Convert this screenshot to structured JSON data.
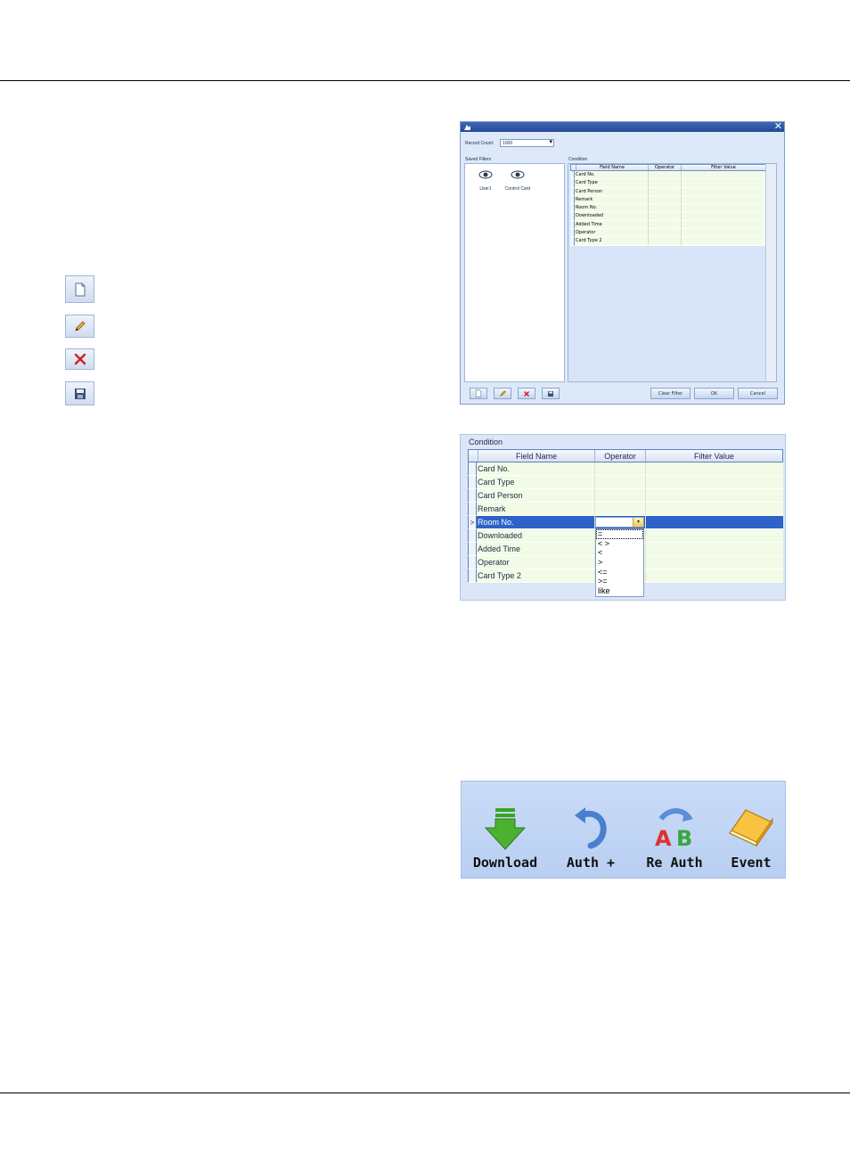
{
  "dialog": {
    "record_count_label": "Record Count:",
    "record_count_value": "1000",
    "saved_filters_label": "Saved Filters",
    "condition_label": "Condition",
    "saved_filters": [
      {
        "label": "User1"
      },
      {
        "label": "Control Card"
      }
    ],
    "grid_headers": [
      "Field Name",
      "Operator",
      "Filter Value"
    ],
    "grid_rows": [
      "Card No.",
      "Card Type",
      "Card Person",
      "Remark",
      "Room No.",
      "Downloaded",
      "Added Time",
      "Operator",
      "Card Type 2"
    ],
    "buttons": {
      "clear_filter": "Clear Filter",
      "ok": "OK",
      "cancel": "Cancel"
    }
  },
  "condition": {
    "title": "Condition",
    "headers": [
      "Field Name",
      "Operator",
      "Filter Value"
    ],
    "rows": [
      {
        "field": "Card No."
      },
      {
        "field": "Card Type"
      },
      {
        "field": "Card Person"
      },
      {
        "field": "Remark"
      },
      {
        "field": "Room No.",
        "selected": true
      },
      {
        "field": "Downloaded"
      },
      {
        "field": "Added Time"
      },
      {
        "field": "Operator"
      },
      {
        "field": "Card Type 2"
      }
    ],
    "row_indicator": ">",
    "operators": [
      "=",
      "< >",
      "<",
      ">",
      "<=",
      ">=",
      "like"
    ],
    "selected_operator": "="
  },
  "toolbar": {
    "items": [
      {
        "label": "Download",
        "icon": "download-arrow-icon"
      },
      {
        "label": "Auth +",
        "icon": "undo-arrow-icon"
      },
      {
        "label": "Re Auth",
        "icon": "ab-swap-icon"
      },
      {
        "label": "Event",
        "icon": "book-icon"
      }
    ]
  },
  "side_icons": [
    "new-icon",
    "edit-pencil-icon",
    "delete-x-icon",
    "save-floppy-icon"
  ],
  "colors": {
    "title_bar": "#2e55a6",
    "selection": "#2e62c8",
    "row_bg": "#f2fbe6",
    "download_green": "#4cb030",
    "delete_red": "#d02020"
  }
}
